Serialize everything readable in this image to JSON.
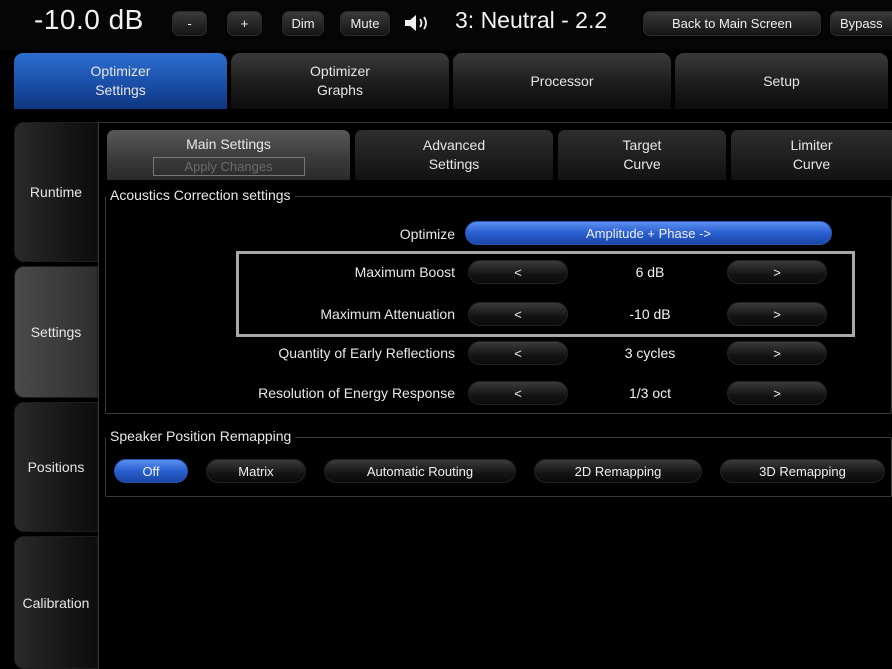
{
  "topbar": {
    "volume": "-10.0 dB",
    "minus_label": "-",
    "plus_label": "+",
    "dim_label": "Dim",
    "mute_label": "Mute",
    "preset": "3: Neutral - 2.2",
    "back_label": "Back to Main Screen",
    "bypass_label": "Bypass"
  },
  "main_tabs": [
    {
      "label": "Optimizer\nSettings"
    },
    {
      "label": "Optimizer\nGraphs"
    },
    {
      "label": "Processor"
    },
    {
      "label": "Setup"
    }
  ],
  "side_tabs": [
    {
      "label": "Runtime"
    },
    {
      "label": "Settings"
    },
    {
      "label": "Positions"
    },
    {
      "label": "Calibration"
    }
  ],
  "sub_tabs": {
    "main": "Main Settings",
    "apply": "Apply Changes",
    "advanced": "Advanced\nSettings",
    "target": "Target\nCurve",
    "limiter": "Limiter\nCurve"
  },
  "acoustics": {
    "title": "Acoustics Correction settings",
    "optimize_label": "Optimize",
    "optimize_value": "Amplitude + Phase ->",
    "rows": [
      {
        "label": "Maximum Boost",
        "prev": "<",
        "value": "6 dB",
        "next": ">"
      },
      {
        "label": "Maximum Attenuation",
        "prev": "<",
        "value": "-10 dB",
        "next": ">"
      },
      {
        "label": "Quantity of Early Reflections",
        "prev": "<",
        "value": "3 cycles",
        "next": ">"
      },
      {
        "label": "Resolution of Energy Response",
        "prev": "<",
        "value": "1/3 oct",
        "next": ">"
      }
    ]
  },
  "remap": {
    "title": "Speaker Position Remapping",
    "buttons": [
      {
        "label": "Off"
      },
      {
        "label": "Matrix"
      },
      {
        "label": "Automatic Routing"
      },
      {
        "label": "2D Remapping"
      },
      {
        "label": "3D Remapping"
      }
    ]
  },
  "colors": {
    "accent": "#2a5fd0",
    "background": "#000000"
  }
}
